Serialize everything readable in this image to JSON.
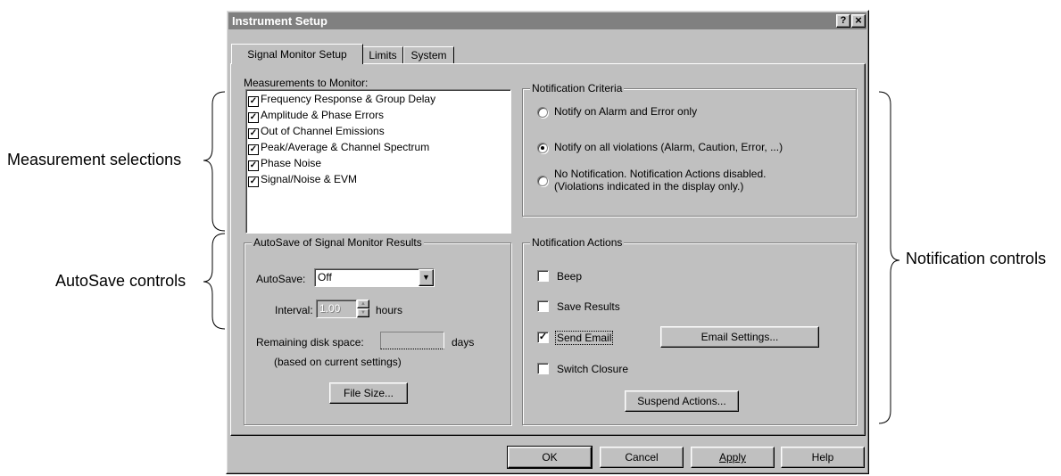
{
  "window": {
    "title": "Instrument Setup",
    "help_button": "?",
    "close_button": "×"
  },
  "tabs": [
    {
      "label": "Signal Monitor Setup",
      "selected": true
    },
    {
      "label": "Limits",
      "selected": false
    },
    {
      "label": "System",
      "selected": false
    }
  ],
  "measurements": {
    "label": "Measurements to Monitor:",
    "items": [
      {
        "label": "Frequency Response & Group Delay",
        "checked": true
      },
      {
        "label": "Amplitude & Phase Errors",
        "checked": true
      },
      {
        "label": "Out of Channel Emissions",
        "checked": true
      },
      {
        "label": "Peak/Average & Channel Spectrum",
        "checked": true
      },
      {
        "label": "Phase Noise",
        "checked": true
      },
      {
        "label": "Signal/Noise & EVM",
        "checked": true
      }
    ]
  },
  "autosave": {
    "group_title": "AutoSave of Signal Monitor Results",
    "autosave_label": "AutoSave:",
    "autosave_value": "Off",
    "interval_label": "Interval:",
    "interval_value": "1.00",
    "interval_unit": "hours",
    "remaining_label": "Remaining disk space:",
    "remaining_value": "",
    "remaining_unit": "days",
    "based_on": "(based on current settings)",
    "file_size_button": "File Size..."
  },
  "criteria": {
    "group_title": "Notification Criteria",
    "options": [
      {
        "label": "Notify on Alarm and Error only",
        "selected": false
      },
      {
        "label": "Notify on all violations (Alarm, Caution, Error, ...)",
        "selected": true
      },
      {
        "label": "No Notification.  Notification Actions disabled.",
        "label2": "(Violations indicated in the display only.)",
        "selected": false
      }
    ]
  },
  "actions": {
    "group_title": "Notification Actions",
    "beep": {
      "label": "Beep",
      "checked": false
    },
    "save_results": {
      "label": "Save Results",
      "checked": false
    },
    "send_email": {
      "label": "Send Email",
      "checked": true
    },
    "switch_closure": {
      "label": "Switch Closure",
      "checked": false
    },
    "email_settings_button": "Email Settings...",
    "suspend_actions_button": "Suspend Actions..."
  },
  "footer": {
    "ok": "OK",
    "cancel": "Cancel",
    "apply": "Apply",
    "help": "Help"
  },
  "callouts": {
    "measurement_selections": "Measurement selections",
    "autosave_controls": "AutoSave controls",
    "notification_controls": "Notification controls"
  },
  "colors": {
    "dialog_bg": "#c0c0c0",
    "title_bar": "#808080",
    "title_text": "#ffffff"
  }
}
